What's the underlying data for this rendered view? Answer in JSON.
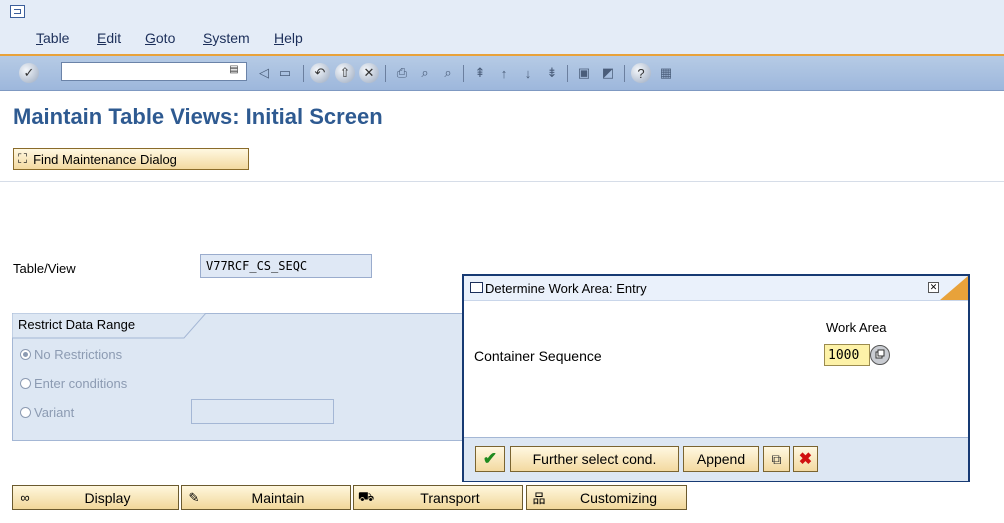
{
  "menu": {
    "items": [
      {
        "label": "Table",
        "u": "T",
        "rest": "able"
      },
      {
        "label": "Edit",
        "u": "E",
        "rest": "dit"
      },
      {
        "label": "Goto",
        "u": "G",
        "rest": "oto"
      },
      {
        "label": "System",
        "u": "S",
        "rest": "ystem"
      },
      {
        "label": "Help",
        "u": "H",
        "rest": "elp"
      }
    ]
  },
  "toolbar": {
    "command_field_value": "",
    "icons": [
      "enter-icon",
      "back-icon",
      "save-icon",
      "back-nav-icon",
      "exit-icon",
      "cancel-icon",
      "print-icon",
      "find-icon",
      "find-next-icon",
      "first-page-icon",
      "previous-page-icon",
      "next-page-icon",
      "last-page-icon",
      "create-session-icon",
      "shortcut-icon",
      "help-icon",
      "layout-icon"
    ]
  },
  "page": {
    "title": "Maintain Table Views: Initial Screen"
  },
  "app_toolbar": {
    "find_dialog_label": "Find Maintenance Dialog"
  },
  "form": {
    "table_view_label": "Table/View",
    "table_view_value": "V77RCF_CS_SEQC",
    "restrict_title": "Restrict Data Range",
    "options": [
      "No Restrictions",
      "Enter conditions",
      "Variant"
    ],
    "selected_option": "No Restrictions",
    "variant_value": ""
  },
  "bottom_buttons": [
    {
      "label": "Display",
      "icon": "glasses-icon"
    },
    {
      "label": "Maintain",
      "icon": "pencil-icon"
    },
    {
      "label": "Transport",
      "icon": "truck-icon"
    },
    {
      "label": "Customizing",
      "icon": "hierarchy-icon"
    }
  ],
  "popup": {
    "title": "Determine Work Area: Entry",
    "column_header": "Work Area",
    "field_label": "Container Sequence",
    "field_value": "1000",
    "buttons": {
      "further": "Further select cond.",
      "append": "Append"
    }
  },
  "colors": {
    "title": "#2e5a91",
    "accent": "#e8a23a",
    "toolbar": "#a9c0e0"
  }
}
